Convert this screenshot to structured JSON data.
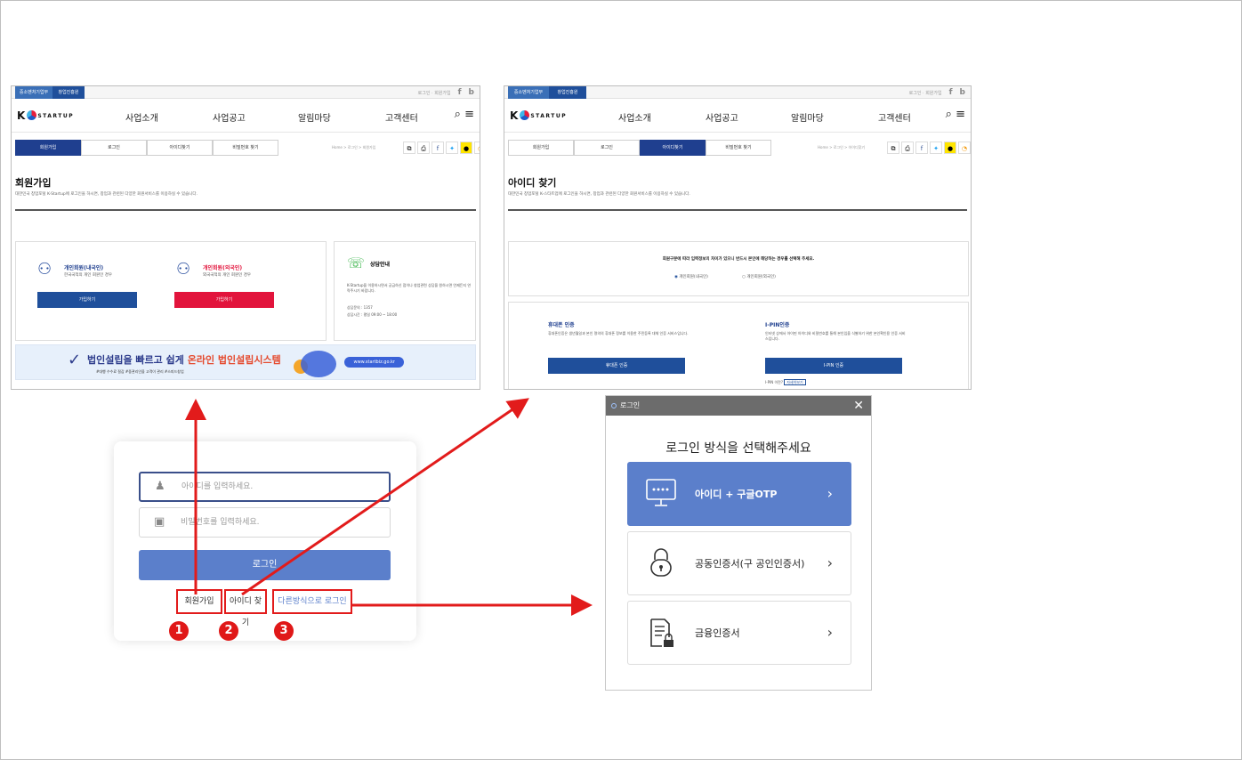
{
  "left_screen": {
    "gov_tab": "중소벤처기업부",
    "agency_tab": "창업진흥원",
    "top_links": "로그인 · 회원가입",
    "menu": [
      "사업소개",
      "사업공고",
      "알림마당",
      "고객센터"
    ],
    "tabs": [
      "회원가입",
      "로그인",
      "아이디찾기",
      "비밀번호 찾기"
    ],
    "breadcrumb": "Home > 로그인 > 회원가입",
    "title": "회원가입",
    "description": "대한민국 창업포털 K-Startup에 로그인을 하시면, 창업과 관련된 다양한 회원서비스를 이용하실 수 있습니다.",
    "member_domestic": "개인회원(내국인)",
    "member_domestic_desc": "한국국적의 개인 회원인 경우",
    "member_foreign": "개인회원(외국인)",
    "member_foreign_desc": "외국국적의 개인 회원인 경우",
    "join_button": "가입하기",
    "consult_title": "상담안내",
    "consult_desc": "K-Startup을 이용하시면서 궁금하신 점이나 창업관련 상담을 원하시면 언제든지 연락주시기 바랍니다.",
    "consult_phone": "상담문의 : 1357",
    "consult_hours": "상담시간 : 평일 09:00 ~ 18:00",
    "banner_text_a": "법인설립을 빠르고 쉽게",
    "banner_text_b": "온라인 법인설립시스템",
    "banner_sub": "#대행 수수료 절감  #중관리인을 고객이 관리  #스피드창업",
    "banner_url": "www.startbiz.go.kr"
  },
  "right_screen": {
    "gov_tab": "중소벤처기업부",
    "agency_tab": "창업진흥원",
    "top_links": "로그인 · 회원가입",
    "menu": [
      "사업소개",
      "사업공고",
      "알림마당",
      "고객센터"
    ],
    "tabs": [
      "회원가입",
      "로그인",
      "아이디찾기",
      "비밀번호 찾기"
    ],
    "breadcrumb": "Home > 로그인 > 아이디찾기",
    "title": "아이디 찾기",
    "description": "대한민국 창업포털 K-스타트업에 로그인을 하시면, 창업과 관련된 다양한 회원서비스를 이용하실 수 있습니다.",
    "notice": "회원구분에 따라 입력정보의 차이가 있으니 반드시 본인에 해당하는 경우를 선택해 주세요.",
    "radio_domestic": "개인회원(내국인)",
    "radio_foreign": "개인회원(외국인)",
    "phone_title": "휴대폰 인증",
    "phone_desc": "휴대폰인증은 생년월일과 본인 명의의 휴대폰 정보를 이용한 주민등록 대체 인증 서비스입니다.",
    "phone_button": "휴대폰 인증",
    "ipin_title": "I-PIN인증",
    "ipin_desc": "인터넷 상에서 아이핀 아이디와 비밀번호를 통해 본인임을 식별하기 위한 본인확인용 인증 서비스입니다.",
    "ipin_button": "I-PIN 인증",
    "ipin_note": "I-PIN 이란?",
    "ipin_note_btn": "자세히보기"
  },
  "login_form": {
    "id_placeholder": "아이디를 입력하세요.",
    "pw_placeholder": "비밀번호를 입력하세요.",
    "login_button": "로그인",
    "signup_link": "회원가입",
    "find_id_link": "아이디 찾기",
    "other_login_link": "다른방식으로 로그인",
    "badges": [
      "1",
      "2",
      "3"
    ]
  },
  "modal": {
    "header": "로그인",
    "title": "로그인 방식을 선택해주세요",
    "options": [
      {
        "label": "아이디 + 구글OTP",
        "icon": "monitor-password-icon",
        "selected": true
      },
      {
        "label": "공동인증서(구 공인인증서)",
        "icon": "lock-icon",
        "selected": false
      },
      {
        "label": "금융인증서",
        "icon": "document-lock-icon",
        "selected": false
      }
    ]
  },
  "colors": {
    "accent_blue": "#5b7fcb",
    "navy": "#1f3f8f",
    "annotation_red": "#e21b1b",
    "join_red": "#e2143c"
  }
}
